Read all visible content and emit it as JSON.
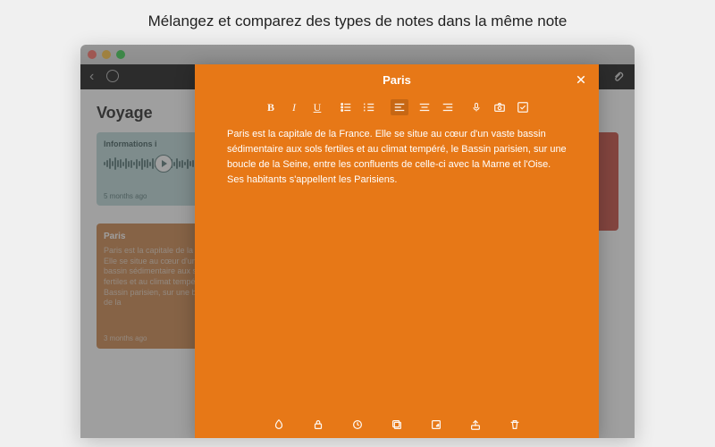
{
  "promo": {
    "headline": "Mélangez et comparez des types de notes dans la même note"
  },
  "window": {
    "page_title": "Voyage"
  },
  "toolbar": {
    "back_label": "‹"
  },
  "cards": {
    "audio": {
      "title": "Informations i",
      "age": "5 months ago"
    },
    "red": {
      "line1": "",
      "line2": ""
    },
    "text": {
      "title": "Paris",
      "body": "Paris est la capitale de la France. Elle se situe au cœur d'un vaste bassin sédimentaire aux sols fertiles et au climat tempéré, le Bassin parisien, sur une boucle de la",
      "age": "3 months ago"
    }
  },
  "editor": {
    "title": "Paris",
    "body": "Paris est la capitale de la France. Elle se situe au cœur d'un vaste bassin sédimentaire aux sols fertiles et au climat tempéré, le Bassin parisien, sur une boucle de la Seine, entre les confluents de celle-ci avec la Marne et l'Oise. Ses habitants s'appellent les Parisiens.",
    "format_labels": {
      "bold": "B",
      "italic": "I",
      "underline": "U"
    }
  }
}
